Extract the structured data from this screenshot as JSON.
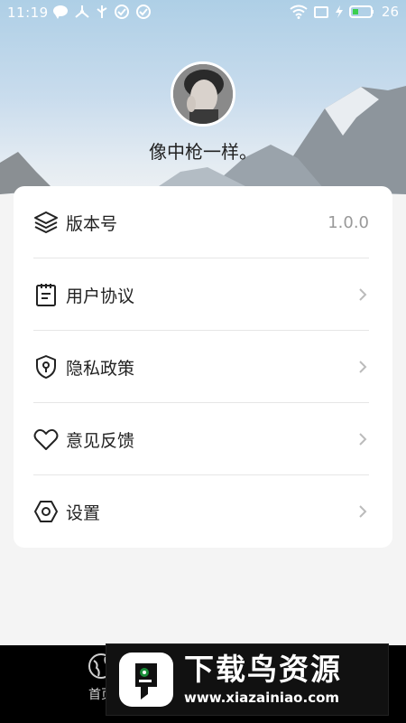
{
  "status_bar": {
    "time": "11:19",
    "battery_level": "26",
    "icons": [
      "chat-icon",
      "share-icon",
      "usb-icon",
      "check-circle-icon",
      "check-circle-icon",
      "wifi-icon",
      "screen-icon",
      "charging-icon",
      "battery-icon"
    ]
  },
  "profile": {
    "username": "像中枪一样。"
  },
  "menu": {
    "items": [
      {
        "label": "版本号",
        "value": "1.0.0",
        "icon": "layers-icon"
      },
      {
        "label": "用户协议",
        "icon": "clipboard-icon"
      },
      {
        "label": "隐私政策",
        "icon": "shield-key-icon"
      },
      {
        "label": "意见反馈",
        "icon": "heart-icon"
      },
      {
        "label": "设置",
        "icon": "hexagon-settings-icon"
      }
    ]
  },
  "bottom_nav": {
    "home_label": "首页"
  },
  "watermark": {
    "title": "下载鸟资源",
    "url": "www.xiazainiao.com"
  },
  "colors": {
    "card_bg": "#ffffff",
    "page_bg": "#f4f4f4",
    "text_primary": "#222222",
    "text_secondary": "#999999",
    "nav_bg": "#000000",
    "watermark_accent": "#1a8f3a"
  }
}
